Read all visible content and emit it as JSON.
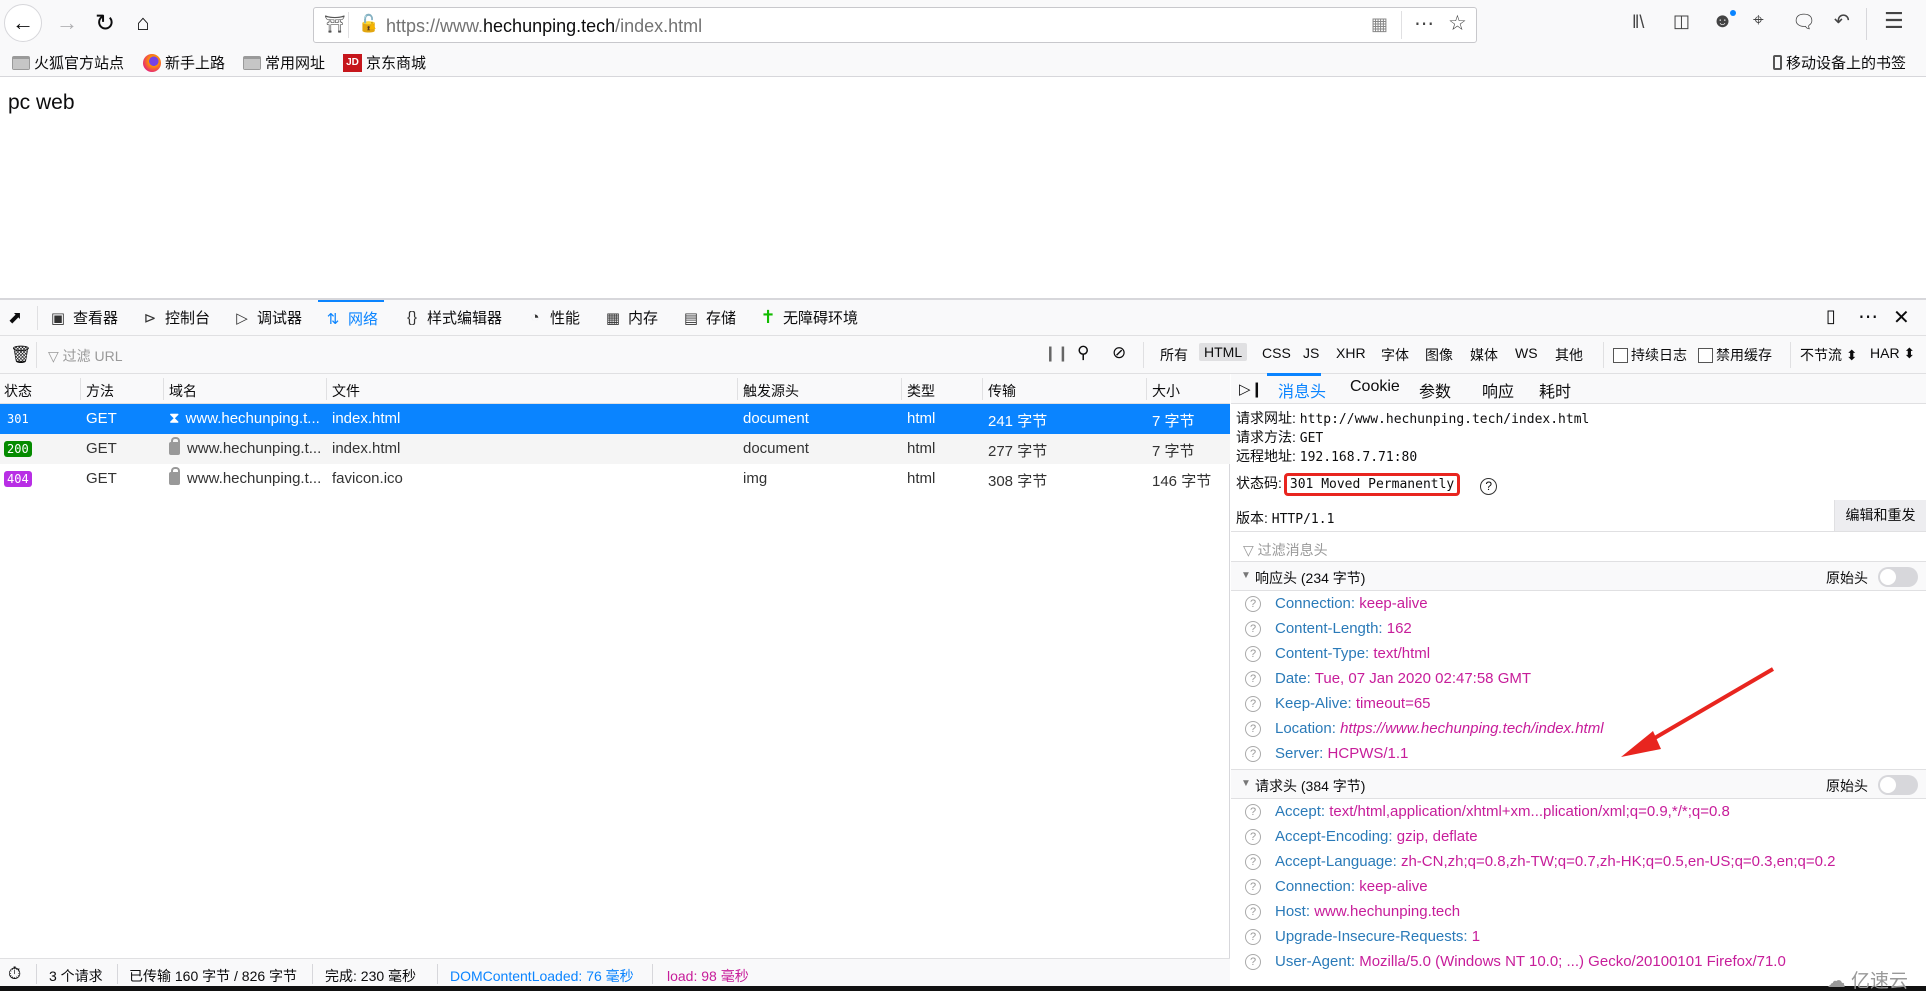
{
  "browser": {
    "url_prefix": "https://www.",
    "url_domain": "hechunping.tech",
    "url_path": "/index.html",
    "bookmarks": [
      {
        "label": "火狐官方站点",
        "icon": "folder-icon"
      },
      {
        "label": "新手上路",
        "icon": "firefox-icon"
      },
      {
        "label": "常用网址",
        "icon": "folder-icon"
      },
      {
        "label": "京东商城",
        "icon": "jd-icon"
      }
    ],
    "mobile_bookmarks": "移动设备上的书签"
  },
  "page": {
    "text": "pc web"
  },
  "devtools": {
    "tabs": [
      {
        "label": "查看器",
        "icon": "inspector-icon"
      },
      {
        "label": "控制台",
        "icon": "console-icon"
      },
      {
        "label": "调试器",
        "icon": "debugger-icon"
      },
      {
        "label": "网络",
        "icon": "network-icon",
        "selected": true
      },
      {
        "label": "样式编辑器",
        "icon": "style-editor-icon"
      },
      {
        "label": "性能",
        "icon": "performance-icon"
      },
      {
        "label": "内存",
        "icon": "memory-icon"
      },
      {
        "label": "存储",
        "icon": "storage-icon"
      },
      {
        "label": "无障碍环境",
        "icon": "accessibility-icon"
      }
    ],
    "filter_placeholder": "过滤 URL",
    "type_filters": [
      "所有",
      "HTML",
      "CSS",
      "JS",
      "XHR",
      "字体",
      "图像",
      "媒体",
      "WS",
      "其他"
    ],
    "selected_type_filter": "HTML",
    "persist_logs": "持续日志",
    "disable_cache": "禁用缓存",
    "throttling": "不节流 ⬍",
    "har": "HAR ⬍",
    "columns": [
      "状态",
      "方法",
      "域名",
      "文件",
      "触发源头",
      "类型",
      "传输",
      "大小"
    ],
    "requests": [
      {
        "status": "301",
        "status_color": "#0a84ff",
        "method": "GET",
        "domain": "www.hechunping.t...",
        "file": "index.html",
        "cause": "document",
        "type": "html",
        "transferred": "241 字节",
        "size": "7 字节",
        "selected": true
      },
      {
        "status": "200",
        "status_color": "#058b00",
        "method": "GET",
        "domain": "www.hechunping.t...",
        "file": "index.html",
        "cause": "document",
        "type": "html",
        "transferred": "277 字节",
        "size": "7 字节"
      },
      {
        "status": "404",
        "status_color": "#b82ee5",
        "method": "GET",
        "domain": "www.hechunping.t...",
        "file": "favicon.ico",
        "cause": "img",
        "type": "html",
        "transferred": "308 字节",
        "size": "146 字节"
      }
    ],
    "status_bar": {
      "requests": "3 个请求",
      "transferred": "已传输 160 字节 / 826 字节",
      "finish": "完成: 230 毫秒",
      "dom_loaded": "DOMContentLoaded: 76 毫秒",
      "load": "load: 98 毫秒"
    },
    "details": {
      "tabs": [
        "消息头",
        "Cookie",
        "参数",
        "响应",
        "耗时"
      ],
      "selected_tab": "消息头",
      "request_url_label": "请求网址:",
      "request_url": "http://www.hechunping.tech/index.html",
      "request_method_label": "请求方法:",
      "request_method": "GET",
      "remote_address_label": "远程地址:",
      "remote_address": "192.168.7.71:80",
      "status_code_label": "状态码:",
      "status_code": "301 Moved Permanently",
      "version_label": "版本:",
      "version": "HTTP/1.1",
      "edit_resend": "编辑和重发",
      "filter_headers_placeholder": "过滤消息头",
      "raw_headers": "原始头",
      "response_headers_title": "响应头 (234 字节)",
      "response_headers": [
        {
          "name": "Connection:",
          "value": "keep-alive"
        },
        {
          "name": "Content-Length:",
          "value": "162"
        },
        {
          "name": "Content-Type:",
          "value": "text/html"
        },
        {
          "name": "Date:",
          "value": "Tue, 07 Jan 2020 02:47:58 GMT"
        },
        {
          "name": "Keep-Alive:",
          "value": "timeout=65"
        },
        {
          "name": "Location:",
          "value": "https://www.hechunping.tech/index.html"
        },
        {
          "name": "Server:",
          "value": "HCPWS/1.1"
        }
      ],
      "request_headers_title": "请求头 (384 字节)",
      "request_headers": [
        {
          "name": "Accept:",
          "value": "text/html,application/xhtml+xm...plication/xml;q=0.9,*/*;q=0.8"
        },
        {
          "name": "Accept-Encoding:",
          "value": "gzip, deflate"
        },
        {
          "name": "Accept-Language:",
          "value": "zh-CN,zh;q=0.8,zh-TW;q=0.7,zh-HK;q=0.5,en-US;q=0.3,en;q=0.2"
        },
        {
          "name": "Connection:",
          "value": "keep-alive"
        },
        {
          "name": "Host:",
          "value": "www.hechunping.tech"
        },
        {
          "name": "Upgrade-Insecure-Requests:",
          "value": "1"
        },
        {
          "name": "User-Agent:",
          "value": "Mozilla/5.0 (Windows NT 10.0; ...) Gecko/20100101 Firefox/71.0"
        }
      ]
    }
  },
  "watermark": "亿速云",
  "colors": {
    "accent": "#0a84ff",
    "header_name": "#2a7ab8",
    "header_value": "#c71d9a",
    "annotation": "#e8251f"
  }
}
